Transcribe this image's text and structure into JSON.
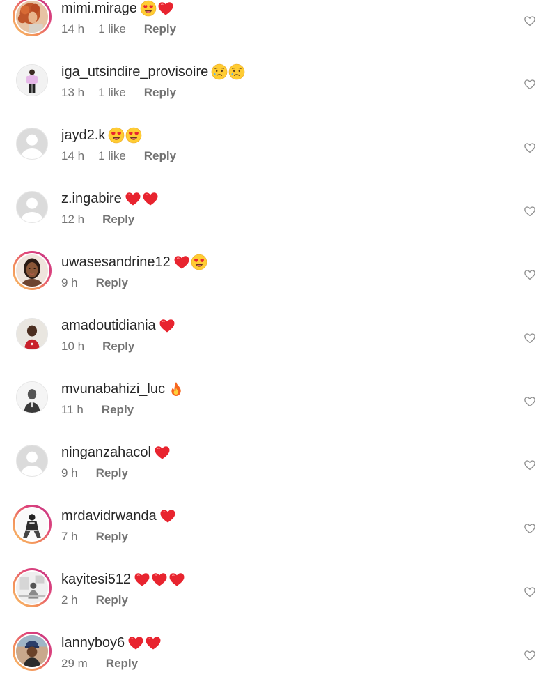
{
  "comments": [
    {
      "username": "mimi.mirage",
      "emojis": [
        "heart-eyes",
        "red-heart"
      ],
      "time": "14 h",
      "likes": "1 like",
      "reply": "Reply",
      "avatar": "photo-woman-curly-hair",
      "ring": true
    },
    {
      "username": "iga_utsindire_provisoire",
      "emojis": [
        "sad-tear",
        "sad-tear"
      ],
      "time": "13 h",
      "likes": "1 like",
      "reply": "Reply",
      "avatar": "photo-man-standing",
      "ring": false
    },
    {
      "username": "jayd2.k",
      "emojis": [
        "heart-eyes",
        "heart-eyes"
      ],
      "time": "14 h",
      "likes": "1 like",
      "reply": "Reply",
      "avatar": "default-avatar",
      "ring": false
    },
    {
      "username": "z.ingabire",
      "emojis": [
        "red-heart",
        "red-heart"
      ],
      "time": "12 h",
      "likes": "",
      "reply": "Reply",
      "avatar": "default-avatar",
      "ring": false
    },
    {
      "username": "uwasesandrine12",
      "emojis": [
        "red-heart",
        "heart-eyes"
      ],
      "time": "9 h",
      "likes": "",
      "reply": "Reply",
      "avatar": "photo-woman-portrait",
      "ring": true
    },
    {
      "username": "amadoutidiania",
      "emojis": [
        "red-heart"
      ],
      "time": "10 h",
      "likes": "",
      "reply": "Reply",
      "avatar": "photo-man-red-shirt",
      "ring": false
    },
    {
      "username": "mvunabahizi_luc",
      "emojis": [
        "fire"
      ],
      "time": "11 h",
      "likes": "",
      "reply": "Reply",
      "avatar": "photo-man-grayscale",
      "ring": false
    },
    {
      "username": "ninganzahacol",
      "emojis": [
        "red-heart"
      ],
      "time": "9 h",
      "likes": "",
      "reply": "Reply",
      "avatar": "default-avatar",
      "ring": false
    },
    {
      "username": "mrdavidrwanda",
      "emojis": [
        "red-heart"
      ],
      "time": "7 h",
      "likes": "",
      "reply": "Reply",
      "avatar": "photo-man-sitting-bw",
      "ring": true
    },
    {
      "username": "kayitesi512",
      "emojis": [
        "red-heart",
        "red-heart",
        "red-heart"
      ],
      "time": "2 h",
      "likes": "",
      "reply": "Reply",
      "avatar": "photo-room-bw",
      "ring": true
    },
    {
      "username": "lannyboy6",
      "emojis": [
        "red-heart",
        "red-heart"
      ],
      "time": "29 m",
      "likes": "",
      "reply": "Reply",
      "avatar": "photo-man-cap",
      "ring": true
    }
  ],
  "like_icon": "heart-outline-icon",
  "colors": {
    "username": "#262626",
    "meta": "#737373",
    "ring_start": "#f9c56b",
    "ring_end": "#c13584",
    "heart": "#ed1c24"
  }
}
